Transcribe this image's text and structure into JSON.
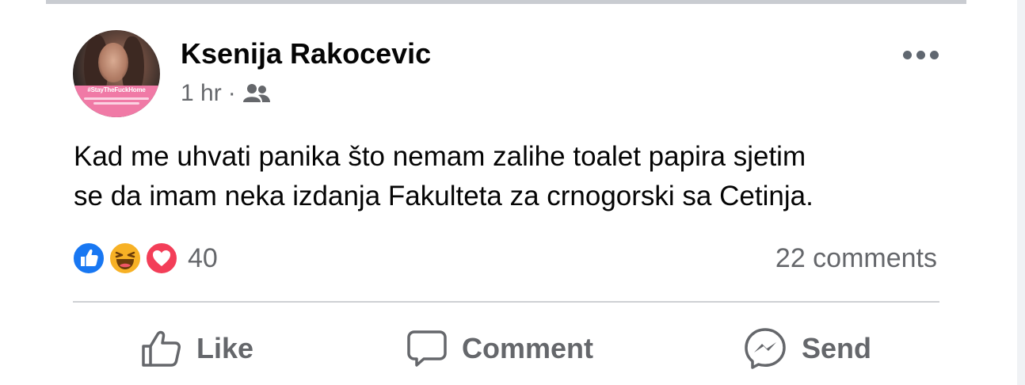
{
  "post": {
    "author": "Ksenija Rakocevic",
    "timestamp": "1 hr",
    "separator": "·",
    "audience_icon": "friends-icon",
    "avatar_banner_text": "#StayTheFuckHome",
    "text_lines": [
      "Kad me uhvati panika što nemam zalihe toalet papira sjetim",
      "se da imam neka izdanja Fakulteta za crnogorski sa Cetinja."
    ],
    "more_icon": "more-options-icon"
  },
  "engagement": {
    "reactions": [
      "like",
      "haha",
      "love"
    ],
    "reaction_count": "40",
    "comments_count": "22 comments"
  },
  "actions": {
    "like_label": "Like",
    "comment_label": "Comment",
    "send_label": "Send"
  },
  "colors": {
    "like_blue": "#1877f2",
    "haha_yellow": "#f7b125",
    "love_red": "#f33e58",
    "secondary_text": "#65676b",
    "banner_pink": "#f07aa6"
  }
}
